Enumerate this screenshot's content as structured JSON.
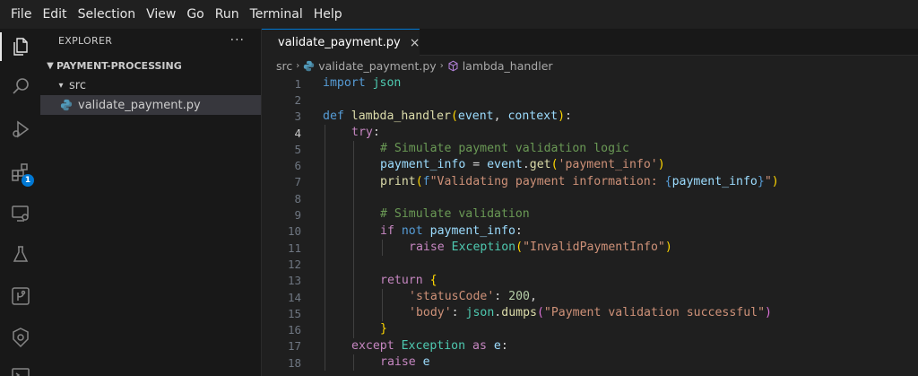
{
  "menu": [
    "File",
    "Edit",
    "Selection",
    "View",
    "Go",
    "Run",
    "Terminal",
    "Help"
  ],
  "activity_bar": {
    "items": [
      "explorer-icon",
      "search-icon",
      "run-debug-icon",
      "extensions-icon",
      "remote-explorer-icon",
      "testing-icon",
      "source-control-icon",
      "kubernetes-icon",
      "terminal-icon"
    ],
    "extensions_badge": "1",
    "accent_color": "#0078d4"
  },
  "sidebar": {
    "title": "EXPLORER",
    "more": "···",
    "root_folder": "PAYMENT-PROCESSING",
    "sub_folder": "src",
    "file": "validate_payment.py"
  },
  "tab": {
    "label": "validate_payment.py",
    "close": "×"
  },
  "breadcrumb": {
    "folder": "src",
    "file": "validate_payment.py",
    "symbol": "lambda_handler"
  },
  "editor": {
    "current_line": 4,
    "lines": [
      {
        "n": "1",
        "indent": 0,
        "tokens": [
          [
            "kw",
            "import"
          ],
          [
            "pl",
            " "
          ],
          [
            "cls",
            "json"
          ]
        ]
      },
      {
        "n": "2",
        "indent": 0,
        "tokens": []
      },
      {
        "n": "3",
        "indent": 0,
        "tokens": [
          [
            "kw",
            "def"
          ],
          [
            "pl",
            " "
          ],
          [
            "fn",
            "lambda_handler"
          ],
          [
            "b1",
            "("
          ],
          [
            "var",
            "event"
          ],
          [
            "pl",
            ", "
          ],
          [
            "var",
            "context"
          ],
          [
            "b1",
            ")"
          ],
          [
            "pl",
            ":"
          ]
        ]
      },
      {
        "n": "4",
        "indent": 1,
        "tokens": [
          [
            "ctl",
            "try"
          ],
          [
            "pl",
            ":"
          ]
        ]
      },
      {
        "n": "5",
        "indent": 2,
        "tokens": [
          [
            "cmt",
            "# Simulate payment validation logic"
          ]
        ]
      },
      {
        "n": "6",
        "indent": 2,
        "tokens": [
          [
            "var",
            "payment_info"
          ],
          [
            "pl",
            " = "
          ],
          [
            "var",
            "event"
          ],
          [
            "pl",
            "."
          ],
          [
            "fn",
            "get"
          ],
          [
            "b1",
            "("
          ],
          [
            "str",
            "'payment_info'"
          ],
          [
            "b1",
            ")"
          ]
        ]
      },
      {
        "n": "7",
        "indent": 2,
        "tokens": [
          [
            "fn",
            "print"
          ],
          [
            "b1",
            "("
          ],
          [
            "kw",
            "f"
          ],
          [
            "str",
            "\"Validating payment information: "
          ],
          [
            "kw",
            "{"
          ],
          [
            "var",
            "payment_info"
          ],
          [
            "kw",
            "}"
          ],
          [
            "str",
            "\""
          ],
          [
            "b1",
            ")"
          ]
        ]
      },
      {
        "n": "8",
        "indent": 2,
        "tokens": []
      },
      {
        "n": "9",
        "indent": 2,
        "tokens": [
          [
            "cmt",
            "# Simulate validation"
          ]
        ]
      },
      {
        "n": "10",
        "indent": 2,
        "tokens": [
          [
            "ctl",
            "if"
          ],
          [
            "pl",
            " "
          ],
          [
            "kw",
            "not"
          ],
          [
            "pl",
            " "
          ],
          [
            "var",
            "payment_info"
          ],
          [
            "pl",
            ":"
          ]
        ]
      },
      {
        "n": "11",
        "indent": 3,
        "tokens": [
          [
            "ctl",
            "raise"
          ],
          [
            "pl",
            " "
          ],
          [
            "cls",
            "Exception"
          ],
          [
            "b1",
            "("
          ],
          [
            "str",
            "\"InvalidPaymentInfo\""
          ],
          [
            "b1",
            ")"
          ]
        ]
      },
      {
        "n": "12",
        "indent": 2,
        "tokens": []
      },
      {
        "n": "13",
        "indent": 2,
        "tokens": [
          [
            "ctl",
            "return"
          ],
          [
            "pl",
            " "
          ],
          [
            "b1",
            "{"
          ]
        ]
      },
      {
        "n": "14",
        "indent": 3,
        "tokens": [
          [
            "str",
            "'statusCode'"
          ],
          [
            "pl",
            ": "
          ],
          [
            "num",
            "200"
          ],
          [
            "pl",
            ","
          ]
        ]
      },
      {
        "n": "15",
        "indent": 3,
        "tokens": [
          [
            "str",
            "'body'"
          ],
          [
            "pl",
            ": "
          ],
          [
            "cls",
            "json"
          ],
          [
            "pl",
            "."
          ],
          [
            "fn",
            "dumps"
          ],
          [
            "b2",
            "("
          ],
          [
            "str",
            "\"Payment validation successful\""
          ],
          [
            "b2",
            ")"
          ]
        ]
      },
      {
        "n": "16",
        "indent": 2,
        "tokens": [
          [
            "b1",
            "}"
          ]
        ]
      },
      {
        "n": "17",
        "indent": 1,
        "tokens": [
          [
            "ctl",
            "except"
          ],
          [
            "pl",
            " "
          ],
          [
            "cls",
            "Exception"
          ],
          [
            "pl",
            " "
          ],
          [
            "ctl",
            "as"
          ],
          [
            "pl",
            " "
          ],
          [
            "var",
            "e"
          ],
          [
            "pl",
            ":"
          ]
        ]
      },
      {
        "n": "18",
        "indent": 2,
        "tokens": [
          [
            "ctl",
            "raise"
          ],
          [
            "pl",
            " "
          ],
          [
            "var",
            "e"
          ]
        ]
      }
    ]
  }
}
